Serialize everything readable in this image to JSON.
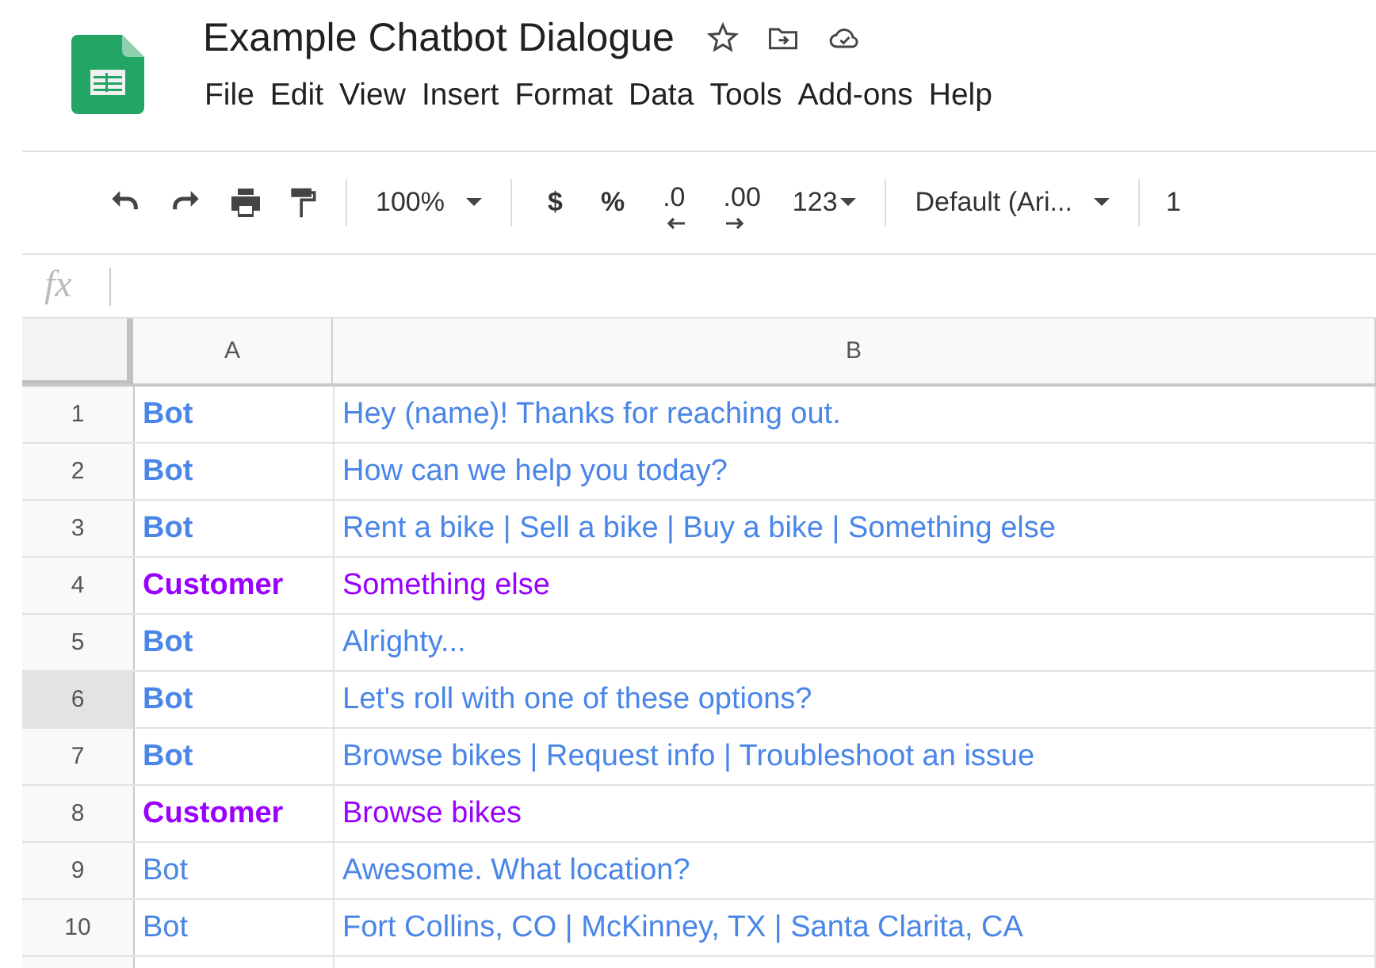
{
  "document": {
    "title": "Example Chatbot Dialogue"
  },
  "menu": [
    "File",
    "Edit",
    "View",
    "Insert",
    "Format",
    "Data",
    "Tools",
    "Add-ons",
    "Help"
  ],
  "toolbar": {
    "zoom": "100%",
    "currency": "$",
    "percent": "%",
    "decrease_decimals": ".0",
    "increase_decimals": ".00",
    "number_format": "123",
    "font": "Default (Ari...",
    "font_size": "1"
  },
  "formula_bar": {
    "label": "fx"
  },
  "columns": [
    {
      "label": "A"
    },
    {
      "label": "B"
    }
  ],
  "rows": [
    {
      "number": "1",
      "selected": false,
      "speaker": "Bot",
      "bold": true,
      "color": "#4a86e8",
      "message": "Hey (name)! Thanks for reaching out."
    },
    {
      "number": "2",
      "selected": false,
      "speaker": "Bot",
      "bold": true,
      "color": "#4a86e8",
      "message": "How can we help you today?"
    },
    {
      "number": "3",
      "selected": false,
      "speaker": "Bot",
      "bold": true,
      "color": "#4a86e8",
      "message": "Rent a bike | Sell a bike | Buy a bike | Something else"
    },
    {
      "number": "4",
      "selected": false,
      "speaker": "Customer",
      "bold": true,
      "color": "#9900ff",
      "message": "Something else"
    },
    {
      "number": "5",
      "selected": false,
      "speaker": "Bot",
      "bold": true,
      "color": "#4a86e8",
      "message": "Alrighty..."
    },
    {
      "number": "6",
      "selected": true,
      "speaker": "Bot",
      "bold": true,
      "color": "#4a86e8",
      "message": "Let's roll with one of these options?"
    },
    {
      "number": "7",
      "selected": false,
      "speaker": "Bot",
      "bold": true,
      "color": "#4a86e8",
      "message": "Browse bikes | Request info | Troubleshoot an issue"
    },
    {
      "number": "8",
      "selected": false,
      "speaker": "Customer",
      "bold": true,
      "color": "#9900ff",
      "message": "Browse bikes"
    },
    {
      "number": "9",
      "selected": false,
      "speaker": "Bot",
      "bold": false,
      "color": "#4a86e8",
      "message": "Awesome. What location?"
    },
    {
      "number": "10",
      "selected": false,
      "speaker": "Bot",
      "bold": false,
      "color": "#4a86e8",
      "message": "Fort Collins, CO | McKinney, TX | Santa Clarita, CA"
    }
  ]
}
